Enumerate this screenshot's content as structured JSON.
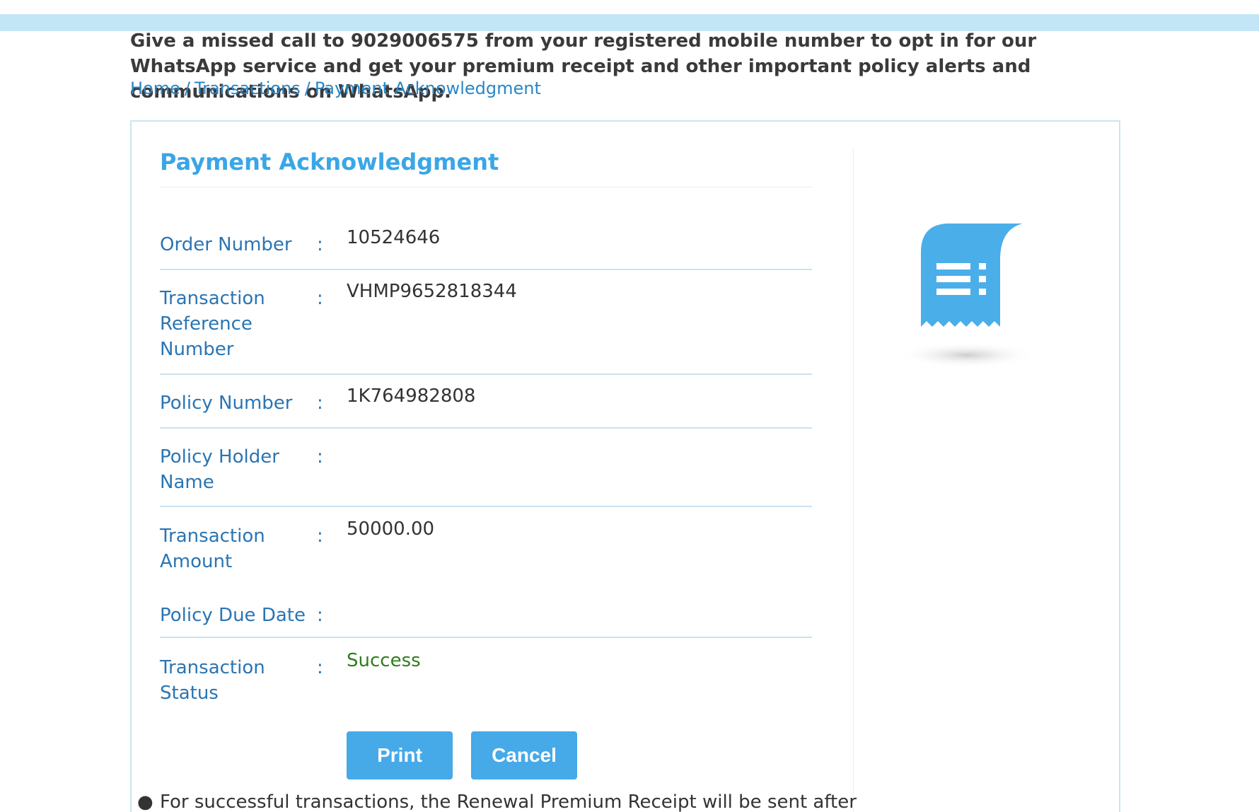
{
  "notice": {
    "text": "Give a missed call to 9029006575 from your registered mobile number to opt in for our WhatsApp service and get your premium receipt and other important policy alerts and communications on WhatsApp."
  },
  "breadcrumb": {
    "items": [
      "Home",
      "Transactions",
      "Payment Acknowledgment"
    ],
    "separator": "/"
  },
  "page": {
    "title": "Payment Acknowledgment"
  },
  "fields": [
    {
      "label": "Order Number",
      "value": "10524646"
    },
    {
      "label": "Transaction Reference Number",
      "value": "VHMP9652818344"
    },
    {
      "label": "Policy Number",
      "value": "1K764982808"
    },
    {
      "label": "Policy Holder Name",
      "value": ""
    },
    {
      "label": "Transaction Amount",
      "value": "50000.00"
    },
    {
      "label": "Policy Due Date",
      "value": ""
    },
    {
      "label": "Transaction Status",
      "value": "Success"
    }
  ],
  "colon": ":",
  "buttons": {
    "print_label": "Print",
    "cancel_label": "Cancel"
  },
  "note": {
    "text": "For successful transactions, the Renewal Premium Receipt will be sent after"
  },
  "icons": {
    "receipt": "receipt-icon"
  },
  "colors": {
    "accent": "#46a9e8",
    "label": "#2a75b3",
    "success": "#2e7d1a",
    "top_strip": "#c3e6f7"
  }
}
